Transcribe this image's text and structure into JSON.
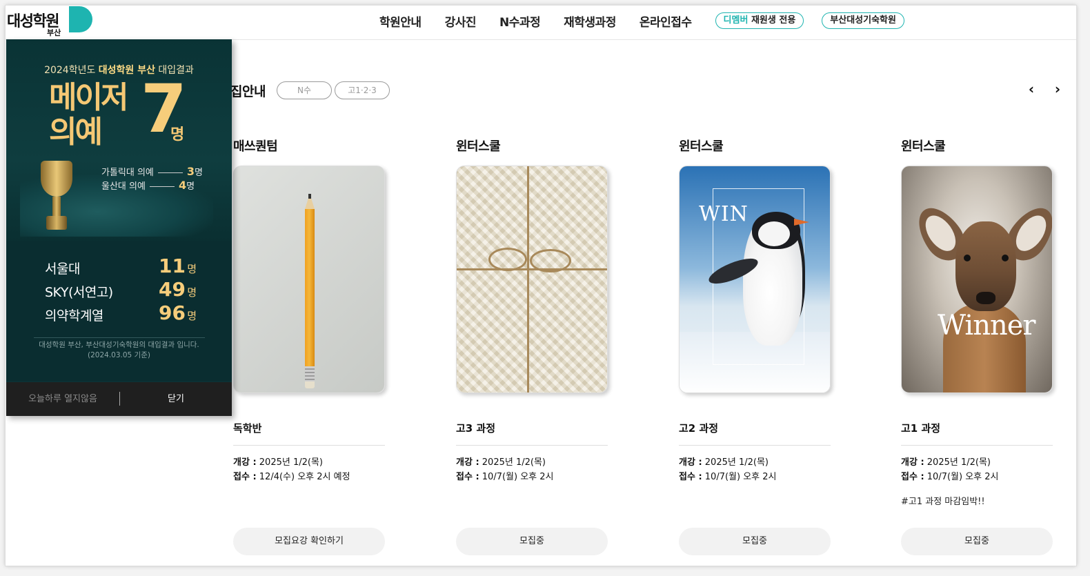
{
  "logo": {
    "text": "대성학원",
    "sub": "부산"
  },
  "nav": {
    "items": [
      "학원안내",
      "강사진",
      "N수과정",
      "재학생과정",
      "온라인접수"
    ],
    "pill1_accent": "디멤버",
    "pill1_rest": " 재원생 전용",
    "pill2": "부산대성기숙학원"
  },
  "section": {
    "title": "집안내",
    "tabs": [
      "N수",
      "고1·2·3"
    ],
    "prev_icon": "chevron-left-icon",
    "next_icon": "chevron-right-icon"
  },
  "cards": [
    {
      "brand": "매쓰퀀텀",
      "image": "pencil",
      "title": "독학반",
      "open_label": "개강 :",
      "open": " 2025년 1/2(목)",
      "apply_label": "접수 :",
      "apply": " 12/4(수) 오후 2시 예정",
      "note": "",
      "button": "모집요강 확인하기"
    },
    {
      "brand": "윈터스쿨",
      "image": "sweater",
      "title": "고3 과정",
      "open_label": "개강 :",
      "open": " 2025년 1/2(목)",
      "apply_label": "접수 :",
      "apply": " 10/7(월) 오후 2시",
      "note": "",
      "button": "모집중"
    },
    {
      "brand": "윈터스쿨",
      "image": "penguin",
      "image_text": "WIN",
      "title": "고2 과정",
      "open_label": "개강 :",
      "open": " 2025년 1/2(목)",
      "apply_label": "접수 :",
      "apply": " 10/7(월) 오후 2시",
      "note": "",
      "button": "모집중"
    },
    {
      "brand": "윈터스쿨",
      "image": "deer",
      "image_text": "Winner",
      "title": "고1 과정",
      "open_label": "개강 :",
      "open": " 2025년 1/2(목)",
      "apply_label": "접수 :",
      "apply": " 10/7(월) 오후 2시",
      "note": "#고1 과정 마감임박!!",
      "button": "모집중"
    }
  ],
  "popup": {
    "headline_pre": "2024학년도 ",
    "headline_bold": "대성학원 부산",
    "headline_post": " 대입결과",
    "major_line1": "메이저",
    "major_line2": "의예",
    "major_count": "7",
    "major_unit": "명",
    "sub_rows": [
      {
        "label": "가톨릭대 의예",
        "count": "3",
        "unit": "명"
      },
      {
        "label": "울산대 의예",
        "count": "4",
        "unit": "명"
      }
    ],
    "stats": [
      {
        "label": "서울대",
        "value": "11",
        "unit": "명"
      },
      {
        "label": "SKY(서연고)",
        "value": "49",
        "unit": "명"
      },
      {
        "label": "의약학계열",
        "value": "96",
        "unit": "명"
      }
    ],
    "note_line1": "대성학원 부산, 부산대성기숙학원의 대입결과 입니다.",
    "note_line2": "(2024.03.05 기준)",
    "dismiss": "오늘하루 열지않음",
    "close": "닫기"
  },
  "colors": {
    "accent": "#1eb4b0",
    "popup_bg": "#0c3438",
    "gold": "#f6cd7b"
  }
}
